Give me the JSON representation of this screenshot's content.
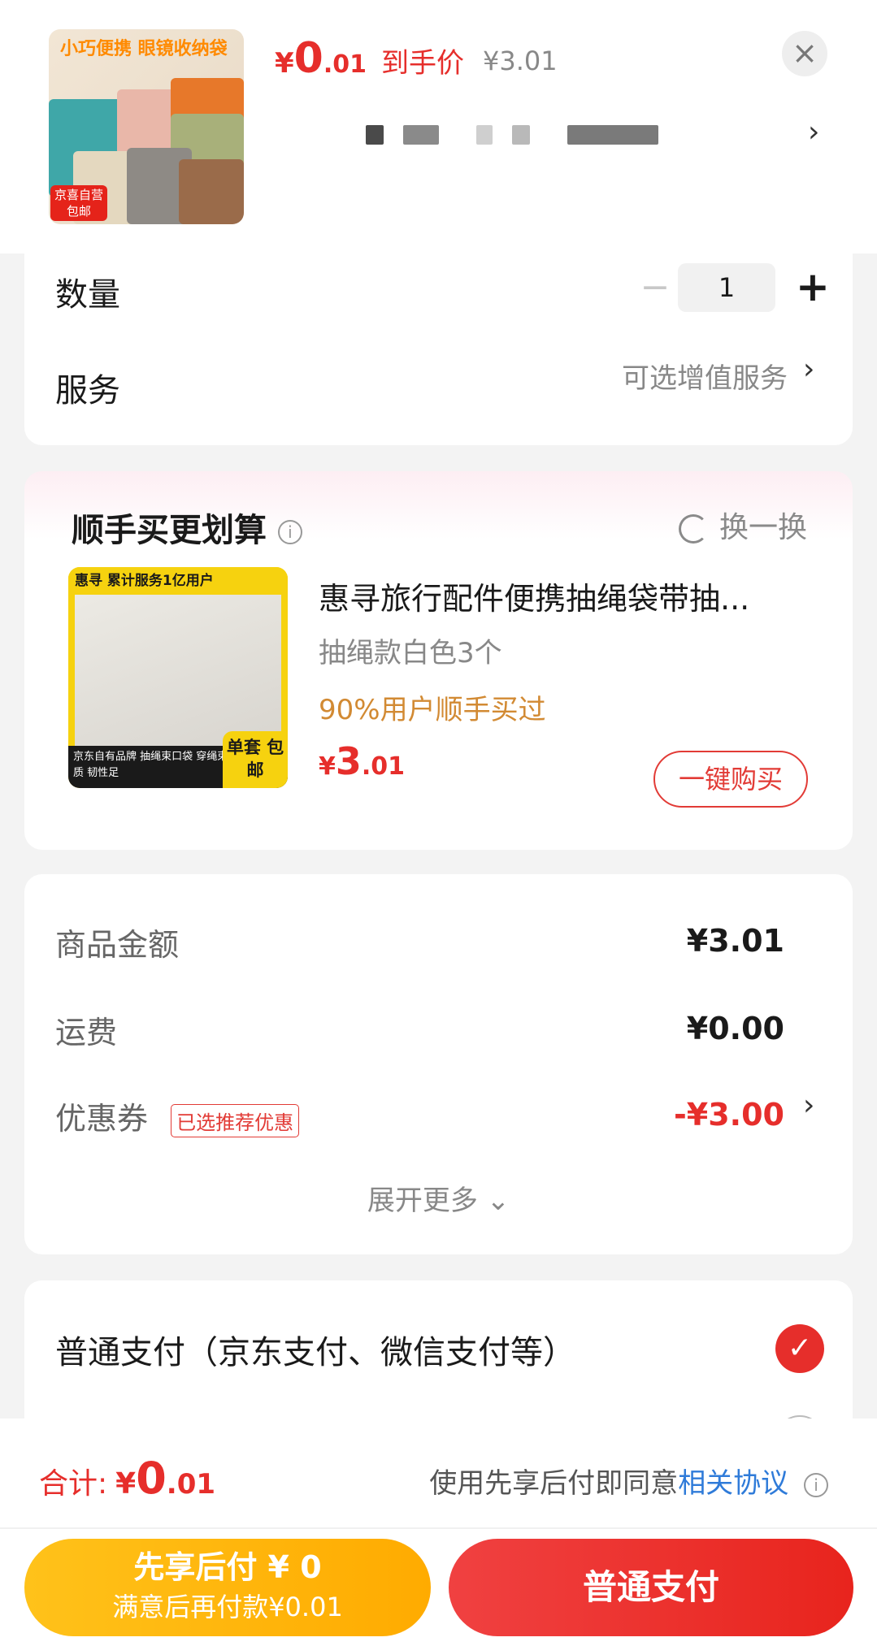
{
  "header": {
    "thumb_text": "小巧便携 眼镜收纳袋",
    "thumb_tag": "京喜自营 包邮",
    "price_yen": "¥",
    "price_int": "0",
    "price_dec": ".01",
    "price_label": "到手价",
    "original_price": "¥3.01",
    "close": "×",
    "spec_chevron": "›"
  },
  "quantity": {
    "label": "数量",
    "minus": "−",
    "value": "1",
    "plus": "+"
  },
  "service": {
    "label": "服务",
    "value": "可选增值服务",
    "chevron": "›"
  },
  "recommend": {
    "title": "顺手买更划算",
    "info": "i",
    "swap_label": "换一换",
    "image_bar": "惠寻  累计服务1亿用户",
    "image_foot": "京东自有品牌 抽绳束口袋 穿绳束口 优质材质 韧性足",
    "image_badge": "单套 包邮",
    "name": "惠寻旅行配件便携抽绳袋带抽...",
    "spec": "抽绳款白色3个",
    "hint": "90%用户顺手买过",
    "price_yen": "¥",
    "price_int": "3",
    "price_dec": ".01",
    "buy_label": "一键购买"
  },
  "amounts": {
    "goods_label": "商品金额",
    "goods_value": "¥3.01",
    "freight_label": "运费",
    "freight_value": "¥0.00",
    "coupon_label": "优惠券",
    "coupon_badge": "已选推荐优惠",
    "coupon_value": "-¥3.00",
    "coupon_chevron": "›",
    "expand": "展开更多 ⌄"
  },
  "payment": {
    "option1": "普通支付（京东支付、微信支付等）",
    "option1_check": "✓"
  },
  "bottom": {
    "total_label": "合计:",
    "total_yen": "¥",
    "total_int": "0",
    "total_dec": ".01",
    "agree_text": "使用先享后付即同意",
    "agree_link": "相关协议",
    "agree_info": "i",
    "later_line1": "先享后付 ¥ 0",
    "later_line2": "满意后再付款¥0.01",
    "normal_pay": "普通支付"
  },
  "colors": {
    "accent_red": "#e62e2b",
    "gold": "#ffb300",
    "link_blue": "#2f7bd9",
    "hint_orange": "#d28a33"
  }
}
